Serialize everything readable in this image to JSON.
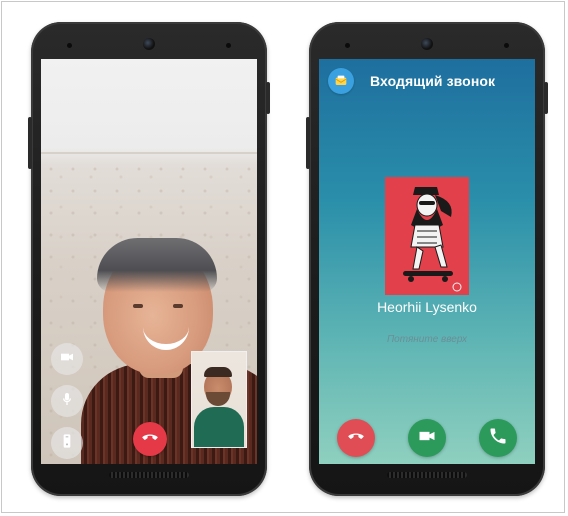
{
  "incoming_call": {
    "title": "Входящий звонок",
    "caller_name": "Heorhii Lysenko",
    "swipe_hint": "Потяните вверх"
  },
  "colors": {
    "decline": "#e53947",
    "accept": "#2b9a5b",
    "header_blue": "#1e6f9e",
    "app_icon": "#3aa0e0"
  },
  "icons": {
    "left_controls": [
      "video-camera-icon",
      "microphone-icon",
      "phone-speaker-icon"
    ],
    "end_call": "phone-hangup-icon",
    "incoming_actions": [
      "phone-hangup-icon",
      "video-camera-icon",
      "phone-icon"
    ],
    "app": "messenger-app-icon"
  }
}
